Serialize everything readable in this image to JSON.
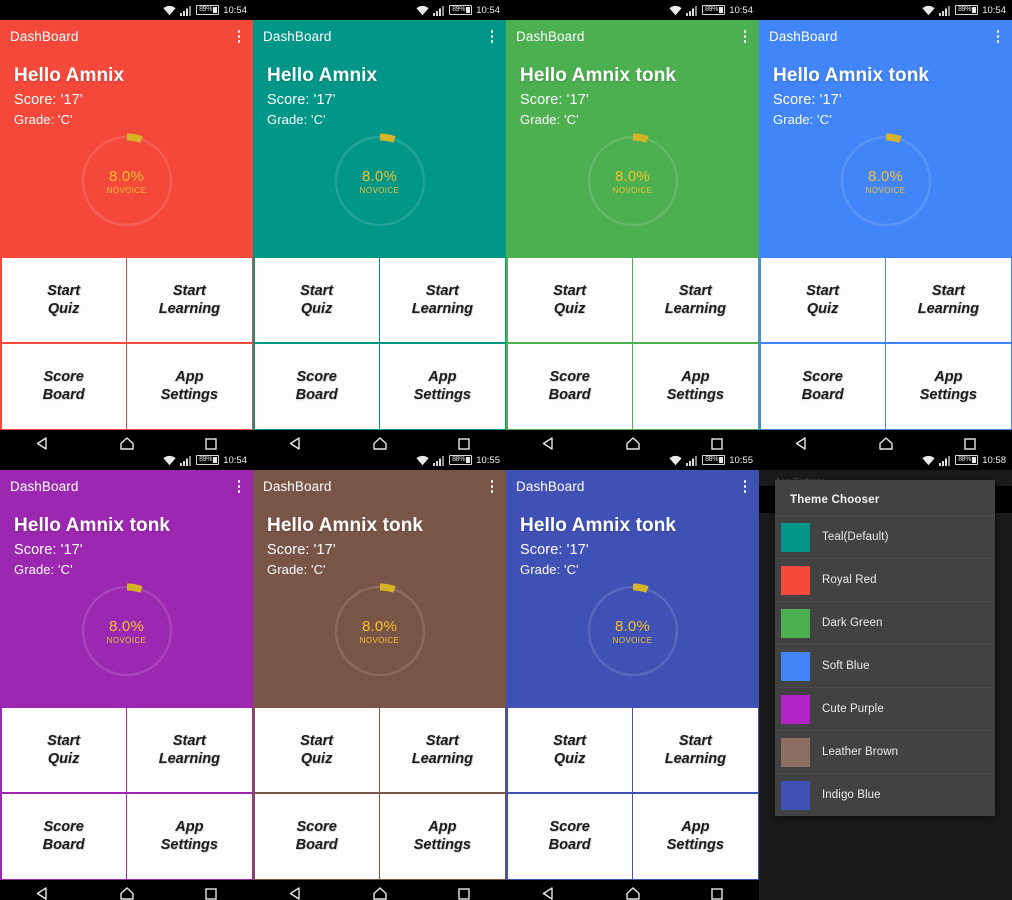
{
  "meta": {
    "app_title": "DashBoard",
    "screen_label": "App Settings"
  },
  "status_bar": {
    "wifi_icon": "wifi-icon",
    "signal_icon": "cellular-signal-icon",
    "battery_icon": "battery-icon"
  },
  "labels": {
    "score": "Score: '17'",
    "grade": "Grade: 'C'",
    "gauge_percent": "8.0%",
    "gauge_rank": "NOVOICE"
  },
  "buttons": {
    "start_quiz_line1": "Start",
    "start_quiz_line2": "Quiz",
    "start_learning_line1": "Start",
    "start_learning_line2": "Learning",
    "score_board_line1": "Score",
    "score_board_line2": "Board",
    "app_settings_line1": "App",
    "app_settings_line2": "Settings"
  },
  "navbar": {
    "back": "back-icon",
    "home": "home-icon",
    "recents": "recents-icon"
  },
  "panels": [
    {
      "id": "royal-red",
      "color": "#F4483A",
      "bar_color": "#F4483A",
      "greeting": "Hello Amnix",
      "battery": "89%",
      "time": "10:54"
    },
    {
      "id": "teal",
      "color": "#009688",
      "bar_color": "#009688",
      "greeting": "Hello Amnix",
      "battery": "89%",
      "time": "10:54"
    },
    {
      "id": "dark-green",
      "color": "#4CAF50",
      "bar_color": "#4CAF50",
      "greeting": "Hello Amnix tonk",
      "battery": "89%",
      "time": "10:54"
    },
    {
      "id": "soft-blue",
      "color": "#4285F8",
      "bar_color": "#4285F8",
      "greeting": "Hello Amnix tonk",
      "battery": "89%",
      "time": "10:54"
    },
    {
      "id": "cute-purple",
      "color": "#9C27B0",
      "bar_color": "#9C27B0",
      "greeting": "Hello Amnix tonk",
      "battery": "89%",
      "time": "10:54"
    },
    {
      "id": "leather-brown",
      "color": "#795548",
      "bar_color": "#795548",
      "greeting": "Hello Amnix tonk",
      "battery": "88%",
      "time": "10:55"
    },
    {
      "id": "indigo-blue",
      "color": "#3F51B5",
      "bar_color": "#3F51B5",
      "greeting": "Hello Amnix tonk",
      "battery": "88%",
      "time": "10:55"
    }
  ],
  "settings_screen": {
    "battery": "88%",
    "time": "10:58",
    "dialog_title": "Theme Chooser",
    "themes": [
      {
        "label": "Teal(Default)",
        "color": "#009688"
      },
      {
        "label": "Royal Red",
        "color": "#F4483A"
      },
      {
        "label": "Dark Green",
        "color": "#4CAF50"
      },
      {
        "label": "Soft Blue",
        "color": "#4285F8"
      },
      {
        "label": "Cute Purple",
        "color": "#B324C6"
      },
      {
        "label": "Leather Brown",
        "color": "#8D6E63"
      },
      {
        "label": "Indigo Blue",
        "color": "#3F51B5"
      }
    ]
  }
}
